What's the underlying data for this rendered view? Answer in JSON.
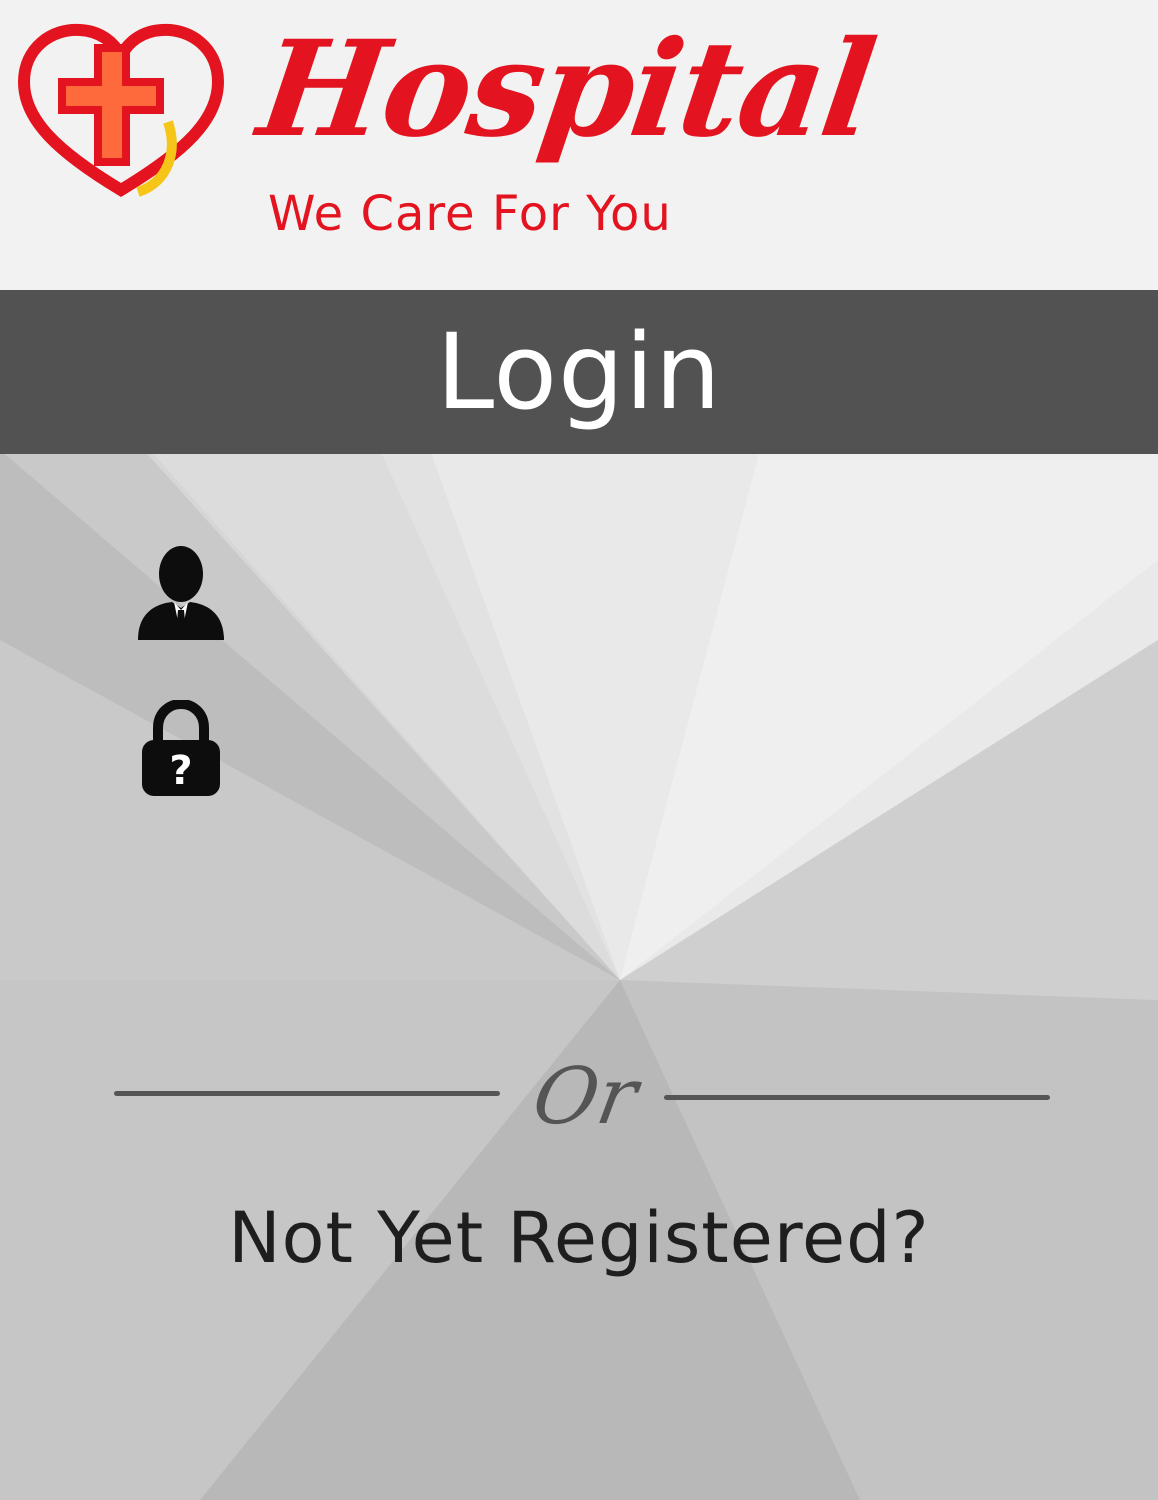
{
  "brand": {
    "name": "Hospital",
    "tagline": "We Care For You",
    "logo_icon": "heart-cross-logo",
    "color": "#e3141f"
  },
  "login": {
    "title": "Login",
    "bar_color": "#525252"
  },
  "fields": {
    "username": {
      "icon": "user-icon",
      "value": "",
      "placeholder": ""
    },
    "password": {
      "icon": "lock-question-icon",
      "value": "",
      "placeholder": ""
    }
  },
  "divider": {
    "text": "Or"
  },
  "register": {
    "label": "Not Yet Registered?"
  }
}
